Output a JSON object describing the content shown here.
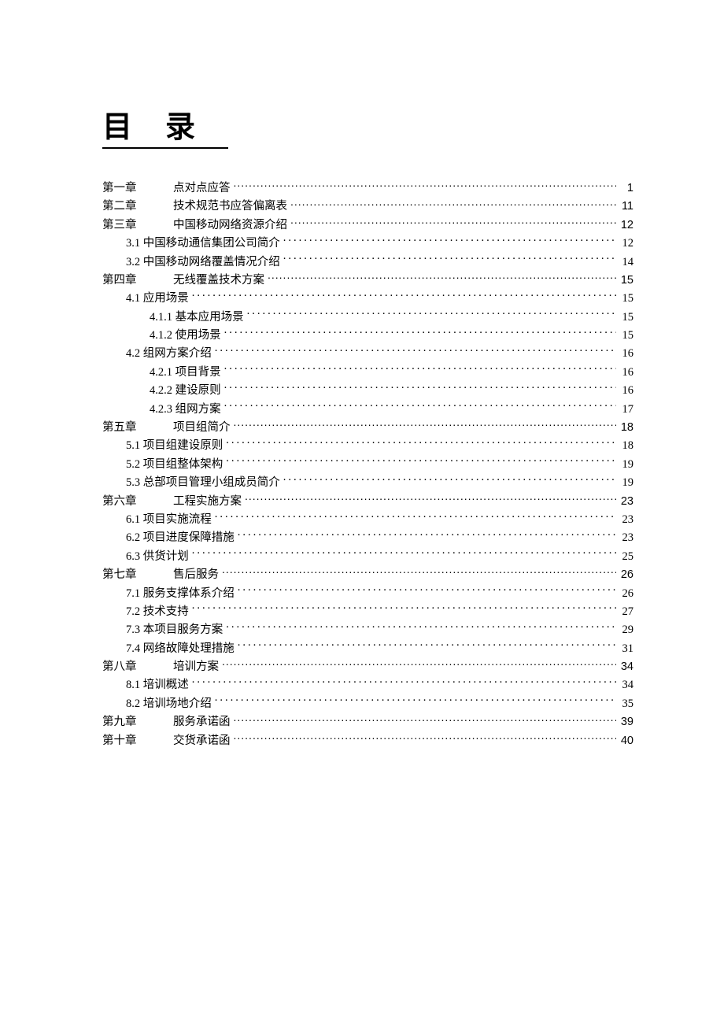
{
  "title": "目录",
  "entries": [
    {
      "level": 0,
      "chapter": "第一章",
      "label": "点对点应答",
      "page": "1"
    },
    {
      "level": 0,
      "chapter": "第二章",
      "label": "技术规范书应答偏离表",
      "page": "11"
    },
    {
      "level": 0,
      "chapter": "第三章",
      "label": "中国移动网络资源介绍",
      "page": "12"
    },
    {
      "level": 1,
      "chapter": "",
      "label": "3.1 中国移动通信集团公司简介",
      "page": "12"
    },
    {
      "level": 1,
      "chapter": "",
      "label": "3.2 中国移动网络覆盖情况介绍",
      "page": "14"
    },
    {
      "level": 0,
      "chapter": "第四章",
      "label": "无线覆盖技术方案",
      "page": "15"
    },
    {
      "level": 1,
      "chapter": "",
      "label": "4.1 应用场景",
      "page": "15"
    },
    {
      "level": 2,
      "chapter": "",
      "label": "4.1.1 基本应用场景",
      "page": "15"
    },
    {
      "level": 2,
      "chapter": "",
      "label": "4.1.2 使用场景",
      "page": "15"
    },
    {
      "level": 1,
      "chapter": "",
      "label": "4.2 组网方案介绍",
      "page": "16"
    },
    {
      "level": 2,
      "chapter": "",
      "label": "4.2.1 项目背景",
      "page": "16"
    },
    {
      "level": 2,
      "chapter": "",
      "label": "4.2.2 建设原则",
      "page": "16"
    },
    {
      "level": 2,
      "chapter": "",
      "label": "4.2.3 组网方案",
      "page": "17"
    },
    {
      "level": 0,
      "chapter": "第五章",
      "label": "项目组简介",
      "page": "18"
    },
    {
      "level": 1,
      "chapter": "",
      "label": "5.1 项目组建设原则",
      "page": "18"
    },
    {
      "level": 1,
      "chapter": "",
      "label": "5.2 项目组整体架构",
      "page": "19"
    },
    {
      "level": 1,
      "chapter": "",
      "label": "5.3 总部项目管理小组成员简介",
      "page": "19"
    },
    {
      "level": 0,
      "chapter": "第六章",
      "label": "工程实施方案",
      "page": "23"
    },
    {
      "level": 1,
      "chapter": "",
      "label": "6.1 项目实施流程",
      "page": "23"
    },
    {
      "level": 1,
      "chapter": "",
      "label": "6.2 项目进度保障措施",
      "page": "23"
    },
    {
      "level": 1,
      "chapter": "",
      "label": "6.3 供货计划",
      "page": "25"
    },
    {
      "level": 0,
      "chapter": "第七章",
      "label": "售后服务",
      "page": "26"
    },
    {
      "level": 1,
      "chapter": "",
      "label": "7.1 服务支撑体系介绍",
      "page": "26"
    },
    {
      "level": 1,
      "chapter": "",
      "label": "7.2 技术支持",
      "page": "27"
    },
    {
      "level": 1,
      "chapter": "",
      "label": "7.3 本项目服务方案",
      "page": "29"
    },
    {
      "level": 1,
      "chapter": "",
      "label": "7.4 网络故障处理措施",
      "page": "31"
    },
    {
      "level": 0,
      "chapter": "第八章",
      "label": "培训方案",
      "page": "34"
    },
    {
      "level": 1,
      "chapter": "",
      "label": "8.1 培训概述",
      "page": "34"
    },
    {
      "level": 1,
      "chapter": "",
      "label": "8.2 培训场地介绍",
      "page": "35"
    },
    {
      "level": 0,
      "chapter": "第九章",
      "label": "服务承诺函",
      "page": "39"
    },
    {
      "level": 0,
      "chapter": "第十章",
      "label": "交货承诺函",
      "page": "40"
    }
  ]
}
